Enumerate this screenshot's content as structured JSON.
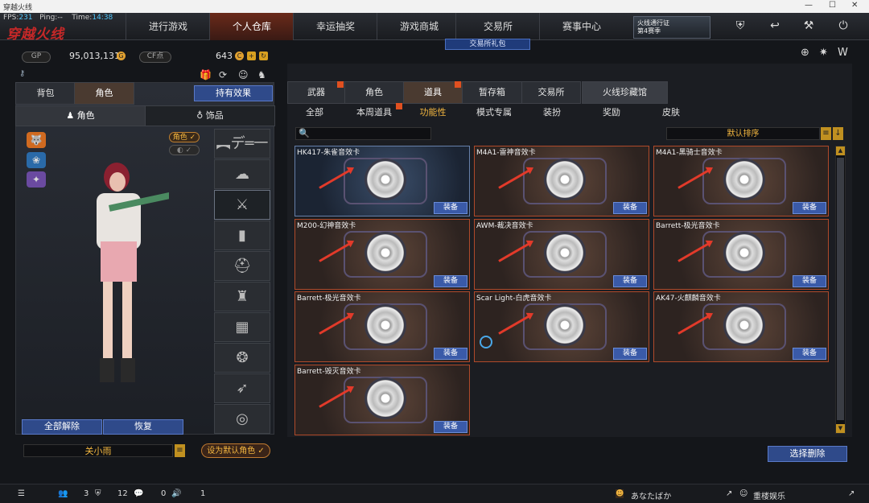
{
  "window": {
    "title": "穿越火线"
  },
  "hud": {
    "fps_label": "FPS:",
    "fps_value": "231",
    "ping_label": "Ping:",
    "ping_value": "--",
    "time_label": "Time:",
    "time_value": "14:38"
  },
  "logo": "穿越火线",
  "nav": [
    "进行游戏",
    "个人仓库",
    "幸运抽奖",
    "游戏商城",
    "交易所",
    "赛事中心"
  ],
  "nav_active": 1,
  "pass": {
    "line1": "火线通行证",
    "line2": "第4赛季"
  },
  "gift_banner": "交易所礼包",
  "currency": {
    "gp_label": "GP",
    "gp_value": "95,013,131",
    "cf_label": "CF点",
    "cf_value": "643"
  },
  "left_tabs": {
    "bag": "背包",
    "character": "角色",
    "effects": "持有效果"
  },
  "left_subtabs": {
    "character": "角色",
    "accessory": "饰品"
  },
  "character_badge": "角色",
  "left_buttons": {
    "unequip_all": "全部解除",
    "restore": "恢复"
  },
  "player_name": "关小雨",
  "set_default": "设为默认角色",
  "main_tabs": [
    "武器",
    "角色",
    "道具",
    "暂存箱",
    "交易所",
    "火线珍藏馆"
  ],
  "main_tab_active": 2,
  "sub_tabs": [
    "全部",
    "本周道具",
    "功能性",
    "模式专属",
    "装扮",
    "奖励",
    "皮肤"
  ],
  "sub_tab_active": 2,
  "search": {
    "placeholder": ""
  },
  "sort": {
    "label": "默认排序"
  },
  "items": [
    {
      "name": "HK417-朱雀音效卡",
      "action": "装备"
    },
    {
      "name": "M4A1-雷神音效卡",
      "action": "装备"
    },
    {
      "name": "M4A1-黑骑士音效卡",
      "action": "装备"
    },
    {
      "name": "M200-幻神音效卡",
      "action": "装备"
    },
    {
      "name": "AWM-裁决音效卡",
      "action": "装备"
    },
    {
      "name": "Barrett-极光音效卡",
      "action": "装备"
    },
    {
      "name": "Barrett-极光音效卡",
      "action": "装备"
    },
    {
      "name": "Scar Light-白虎音效卡",
      "action": "装备"
    },
    {
      "name": "AK47-火麒麟音效卡",
      "action": "装备"
    },
    {
      "name": "Barrett-毁灭音效卡",
      "action": "装备"
    }
  ],
  "bulk_delete": "选择删除",
  "statusbar": {
    "count1": "3",
    "count2": "12",
    "count3": "0",
    "count4": "1",
    "user": "あなたばか",
    "club": "重楼娱乐"
  },
  "colors": {
    "accent": "#f4b740",
    "equip_button": "#3a5aa8",
    "card_border": "#b04a2a",
    "arrow": "#e23a2a"
  }
}
